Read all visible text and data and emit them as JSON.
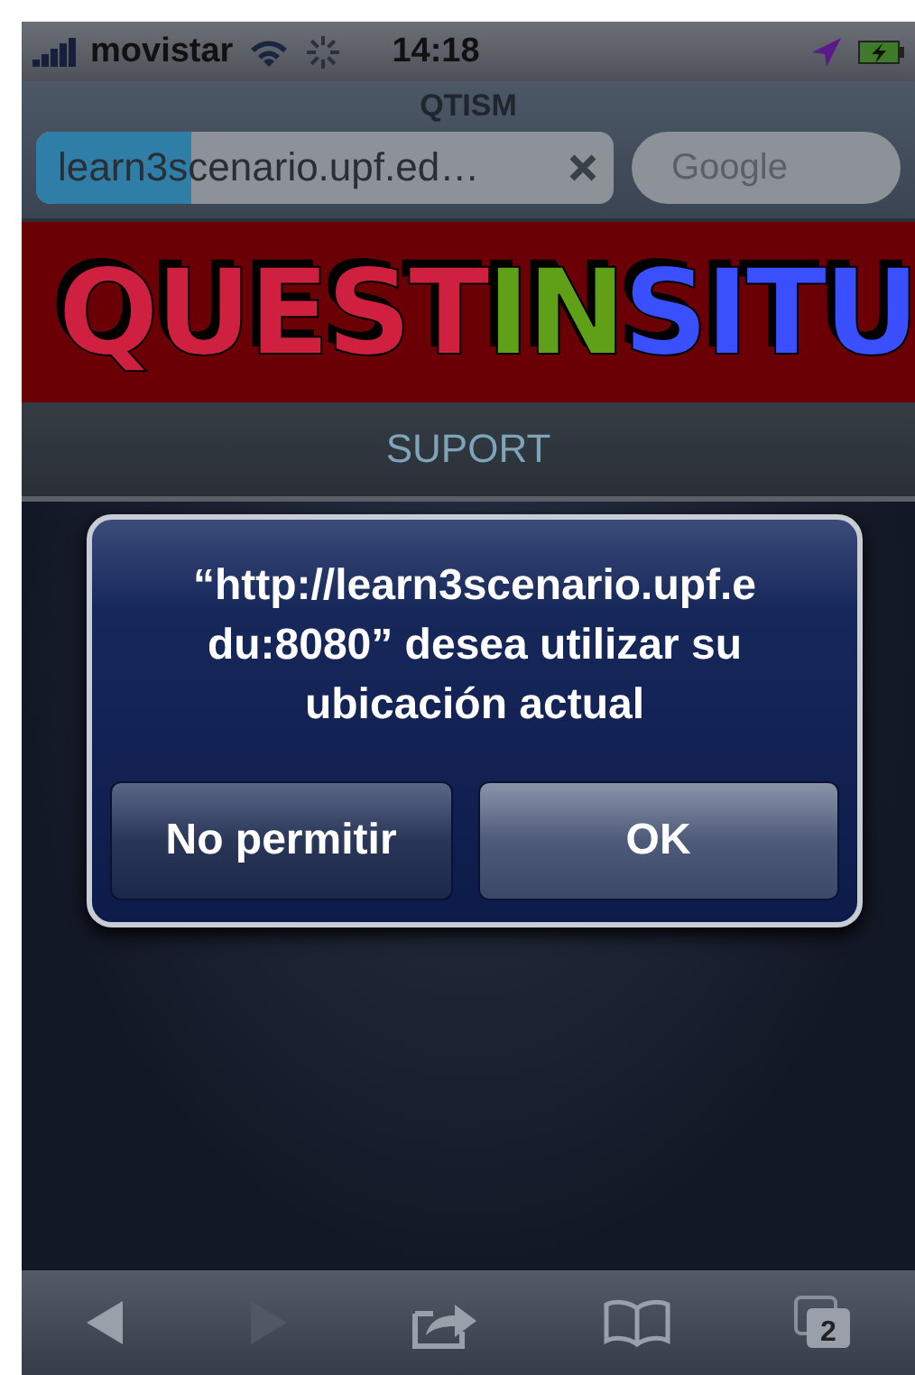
{
  "status_bar": {
    "carrier": "movistar",
    "time": "14:18",
    "loading": true
  },
  "browser": {
    "title": "QTISM",
    "url": "learn3scenario.upf.ed…",
    "level": 0.27,
    "search_placeholder": "Google"
  },
  "banner": {
    "logo": [
      {
        "text": "QUEST",
        "color": "#d02040"
      },
      {
        "text": "IN",
        "color": "#5fa018"
      },
      {
        "text": "SITU",
        "color": "#3a50ff"
      }
    ]
  },
  "page": {
    "heading": "SUPORT"
  },
  "alert": {
    "message": "“http://learn3scenario.upf.e du:8080” desea utilizar su ubicación actual",
    "buttons": [
      {
        "label": "No permitir",
        "kind": "cancel"
      },
      {
        "label": "OK",
        "kind": "default"
      }
    ]
  },
  "toolbar": {
    "back_disabled": false,
    "forward_disabled": true,
    "tab_count": "2"
  }
}
